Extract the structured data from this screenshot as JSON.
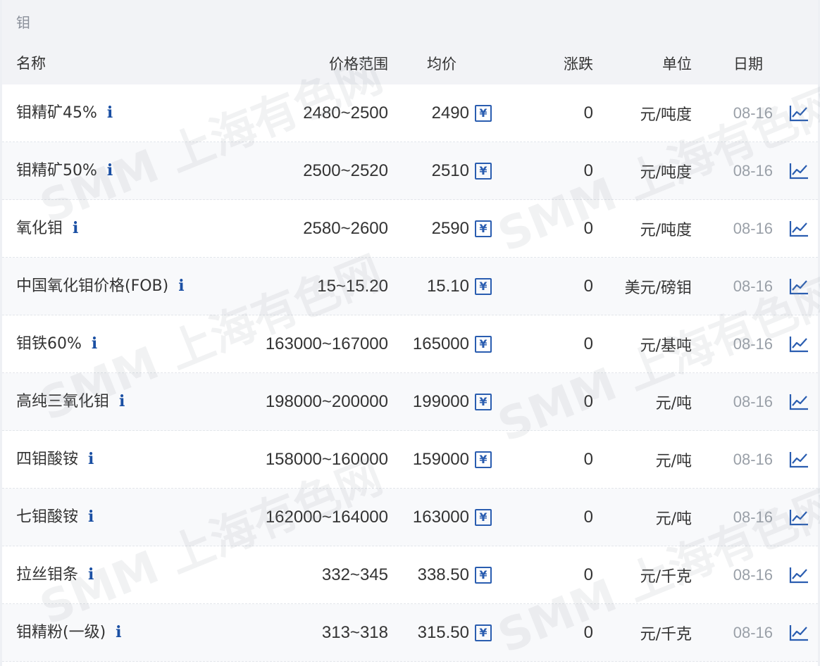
{
  "section": {
    "title": "钼"
  },
  "header": {
    "name": "名称",
    "range": "价格范围",
    "avg": "均价",
    "change": "涨跌",
    "unit": "单位",
    "date": "日期"
  },
  "info_glyph": "i",
  "yen_glyph": "¥",
  "rows": [
    {
      "name": "钼精矿45%",
      "range": "2480~2500",
      "avg": "2490",
      "change": "0",
      "unit": "元/吨度",
      "date": "08-16"
    },
    {
      "name": "钼精矿50%",
      "range": "2500~2520",
      "avg": "2510",
      "change": "0",
      "unit": "元/吨度",
      "date": "08-16"
    },
    {
      "name": "氧化钼",
      "range": "2580~2600",
      "avg": "2590",
      "change": "0",
      "unit": "元/吨度",
      "date": "08-16"
    },
    {
      "name": "中国氧化钼价格(FOB)",
      "range": "15~15.20",
      "avg": "15.10",
      "change": "0",
      "unit": "美元/磅钼",
      "date": "08-16"
    },
    {
      "name": "钼铁60%",
      "range": "163000~167000",
      "avg": "165000",
      "change": "0",
      "unit": "元/基吨",
      "date": "08-16"
    },
    {
      "name": "高纯三氧化钼",
      "range": "198000~200000",
      "avg": "199000",
      "change": "0",
      "unit": "元/吨",
      "date": "08-16"
    },
    {
      "name": "四钼酸铵",
      "range": "158000~160000",
      "avg": "159000",
      "change": "0",
      "unit": "元/吨",
      "date": "08-16"
    },
    {
      "name": "七钼酸铵",
      "range": "162000~164000",
      "avg": "163000",
      "change": "0",
      "unit": "元/吨",
      "date": "08-16"
    },
    {
      "name": "拉丝钼条",
      "range": "332~345",
      "avg": "338.50",
      "change": "0",
      "unit": "元/千克",
      "date": "08-16"
    },
    {
      "name": "钼精粉(一级)",
      "range": "313~318",
      "avg": "315.50",
      "change": "0",
      "unit": "元/千克",
      "date": "08-16"
    }
  ],
  "watermark": {
    "text": "SMM 上海有色网"
  },
  "colors": {
    "accent": "#2a5db0",
    "info": "#1a4fa3",
    "header_bg": "#f2f3f6",
    "date": "#9aa0a8"
  },
  "icons": {
    "info": "info-icon",
    "avg_detail": "yen-calendar-icon",
    "chart": "line-chart-icon"
  }
}
